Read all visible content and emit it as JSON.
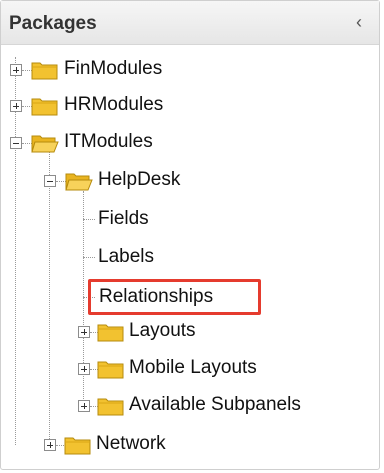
{
  "panel": {
    "title": "Packages",
    "collapse_glyph": "‹"
  },
  "tree": {
    "finmodules": "FinModules",
    "hrmodules": "HRModules",
    "itmodules": "ITModules",
    "helpdesk": "HelpDesk",
    "fields": "Fields",
    "labels": "Labels",
    "relationships": "Relationships",
    "layouts": "Layouts",
    "mobile_layouts": "Mobile Layouts",
    "available_subpanels": "Available Subpanels",
    "network": "Network"
  },
  "colors": {
    "highlight": "#e53b2e",
    "folder": "#f2c230"
  }
}
